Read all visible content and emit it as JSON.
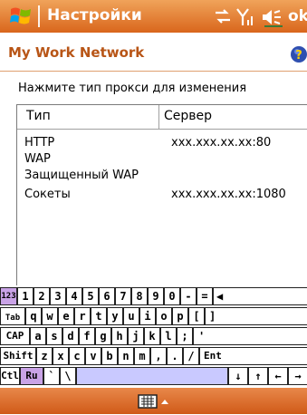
{
  "titlebar": {
    "title": "Настройки",
    "ok_label": "ok"
  },
  "header": {
    "title": "My Work Network"
  },
  "instruction": "Нажмите тип прокси для изменения",
  "proxy_list": {
    "columns": [
      "Тип",
      "Сервер"
    ],
    "rows": [
      {
        "type": "HTTP",
        "server": "xxx.xxx.xx.xx:80"
      },
      {
        "type": "WAP",
        "server": ""
      },
      {
        "type": "Защищенный WAP",
        "server": ""
      },
      {
        "type": "Сокеты",
        "server": "xxx.xxx.xx.xx:1080"
      }
    ]
  },
  "keyboard": {
    "row1": [
      "123",
      "1",
      "2",
      "3",
      "4",
      "5",
      "6",
      "7",
      "8",
      "9",
      "0",
      "-",
      "=",
      "◀"
    ],
    "row2": [
      "Tab",
      "q",
      "w",
      "e",
      "r",
      "t",
      "y",
      "u",
      "i",
      "o",
      "p",
      "[",
      "]"
    ],
    "row3": [
      "CAP",
      "a",
      "s",
      "d",
      "f",
      "g",
      "h",
      "j",
      "k",
      "l",
      ";",
      "'"
    ],
    "row4": [
      "Shift",
      "z",
      "x",
      "c",
      "v",
      "b",
      "n",
      "m",
      ",",
      ".",
      "/",
      "Ent"
    ],
    "row5": [
      "Ctl",
      "Ru",
      "`",
      "\\",
      "",
      "↓",
      "↑",
      "←",
      "→"
    ]
  },
  "colors": {
    "accent": "#d9661c",
    "header_text": "#b85516",
    "key_highlight": "#c9a3e6"
  }
}
